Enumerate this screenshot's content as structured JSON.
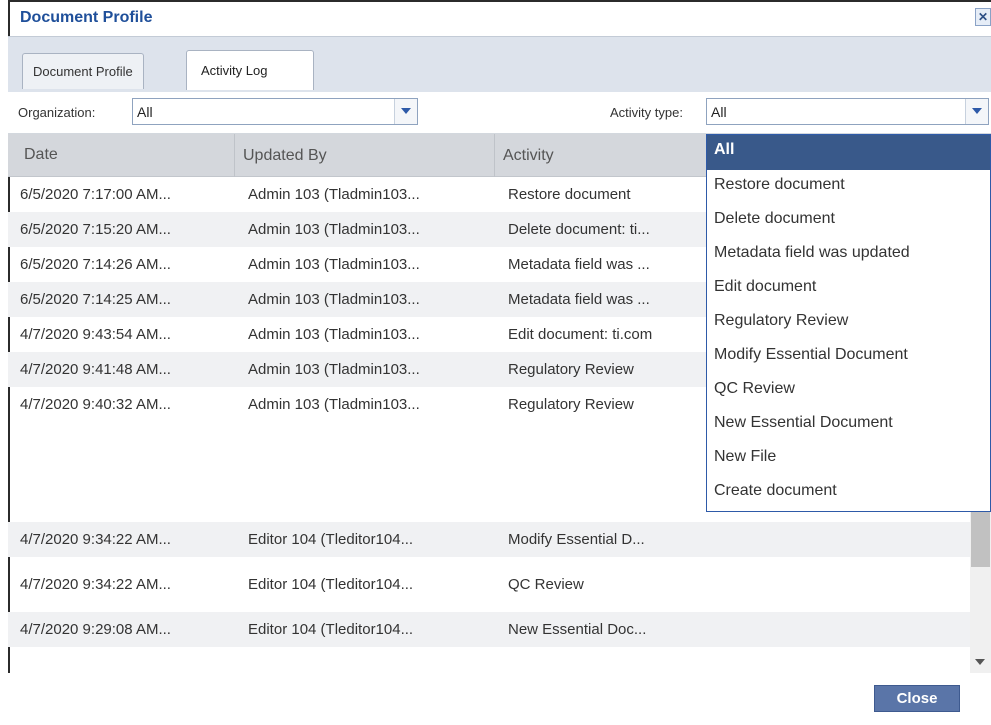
{
  "dialog": {
    "title": "Document Profile",
    "close_icon": "close-icon"
  },
  "tabs": [
    {
      "label": "Document Profile",
      "active": false
    },
    {
      "label": "Activity Log",
      "active": true
    }
  ],
  "filters": {
    "organization_label": "Organization:",
    "organization_value": "All",
    "activity_type_label": "Activity type:",
    "activity_type_value": "All"
  },
  "table": {
    "columns": [
      "Date",
      "Updated By",
      "Activity"
    ],
    "rows": [
      [
        "6/5/2020 7:17:00 AM...",
        "Admin 103 (Tladmin103...",
        "Restore document"
      ],
      [
        "6/5/2020 7:15:20 AM...",
        "Admin 103 (Tladmin103...",
        "Delete document: ti..."
      ],
      [
        "6/5/2020 7:14:26 AM...",
        "Admin 103 (Tladmin103...",
        "Metadata field was ..."
      ],
      [
        "6/5/2020 7:14:25 AM...",
        "Admin 103 (Tladmin103...",
        "Metadata field was ..."
      ],
      [
        "4/7/2020 9:43:54 AM...",
        "Admin 103 (Tladmin103...",
        "Edit document: ti.com"
      ],
      [
        "4/7/2020 9:41:48 AM...",
        "Admin 103 (Tladmin103...",
        "Regulatory Review"
      ],
      [
        "4/7/2020 9:40:32 AM...",
        "Admin 103 (Tladmin103...",
        "Regulatory Review"
      ],
      [
        "4/7/2020 9:34:22 AM...",
        "Editor 104 (Tleditor104...",
        "Modify Essential D..."
      ],
      [
        "4/7/2020 9:34:22 AM...",
        "Editor 104 (Tleditor104...",
        "QC Review"
      ],
      [
        "4/7/2020 9:29:08 AM...",
        "Editor 104 (Tleditor104...",
        "New Essential Doc..."
      ]
    ]
  },
  "activity_dropdown": {
    "selected": "All",
    "options": [
      "All",
      "Restore document",
      "Delete document",
      "Metadata field was updated",
      "Edit document",
      "Regulatory Review",
      "Modify Essential Document",
      "QC Review",
      "New Essential Document",
      "New File",
      "Create document"
    ]
  },
  "footer": {
    "close_label": "Close"
  },
  "colors": {
    "title": "#1f4f9a",
    "selected_option_bg": "#39598a",
    "close_button_bg": "#5a75a8"
  }
}
